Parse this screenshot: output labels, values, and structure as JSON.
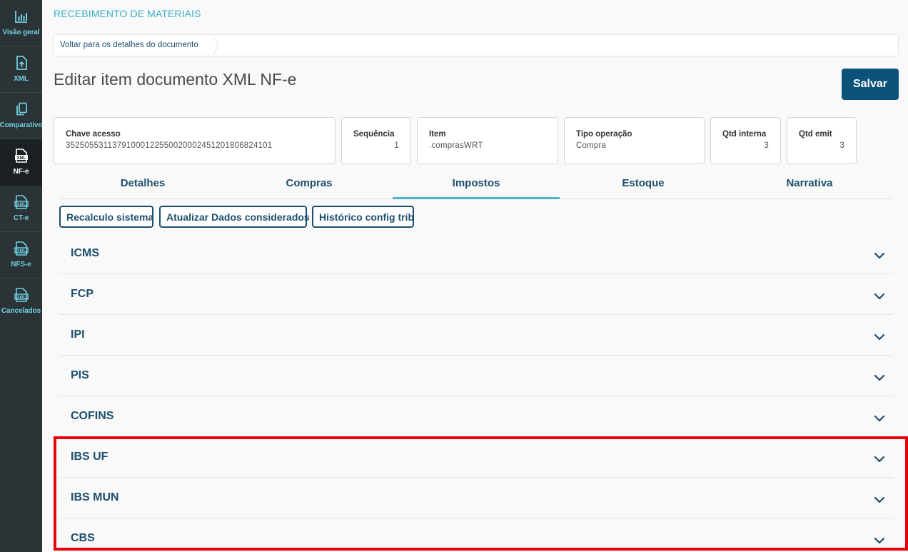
{
  "sidebar": {
    "items": [
      {
        "label": "Visão geral",
        "icon": "bar-chart-icon"
      },
      {
        "label": "XML",
        "icon": "file-upload-icon"
      },
      {
        "label": "Comparativo",
        "icon": "copy-icon"
      },
      {
        "label": "NF-e",
        "icon": "xml-file-icon",
        "active": true
      },
      {
        "label": "CT-e",
        "icon": "xml-file-icon"
      },
      {
        "label": "NFS-e",
        "icon": "xml-file-icon"
      },
      {
        "label": "Cancelados",
        "icon": "xml-file-icon"
      }
    ],
    "xml_badge": "XML"
  },
  "app_title": "RECEBIMENTO DE MATERIAIS",
  "breadcrumb": {
    "back_label": "Voltar para os detalhes do documento"
  },
  "page_title": "Editar item documento XML NF-e",
  "save_label": "Salvar",
  "cards": [
    {
      "label": "Chave acesso",
      "value": "35250553113791000122550020002451201806824101"
    },
    {
      "label": "Sequência",
      "value": "1"
    },
    {
      "label": "Item",
      "value": ".comprasWRT"
    },
    {
      "label": "Tipo operação",
      "value": "Compra"
    },
    {
      "label": "Qtd interna",
      "value": "3"
    },
    {
      "label": "Qtd emit",
      "value": "3"
    }
  ],
  "tabs": [
    {
      "label": "Detalhes"
    },
    {
      "label": "Compras"
    },
    {
      "label": "Impostos",
      "active": true
    },
    {
      "label": "Estoque"
    },
    {
      "label": "Narrativa"
    }
  ],
  "actions": [
    {
      "label": "Recalculo sistema"
    },
    {
      "label": "Atualizar Dados considerados"
    },
    {
      "label": "Histórico config trib"
    }
  ],
  "accordion": [
    {
      "title": "ICMS"
    },
    {
      "title": "FCP"
    },
    {
      "title": "IPI"
    },
    {
      "title": "PIS"
    },
    {
      "title": "COFINS"
    },
    {
      "title": "IBS UF"
    },
    {
      "title": "IBS MUN"
    },
    {
      "title": "CBS"
    }
  ],
  "colors": {
    "sidebar_bg": "#2b3336",
    "accent": "#3ab0c6",
    "primary": "#0d5379",
    "text_primary": "#1c4f6e",
    "highlight": "#e8000b"
  }
}
